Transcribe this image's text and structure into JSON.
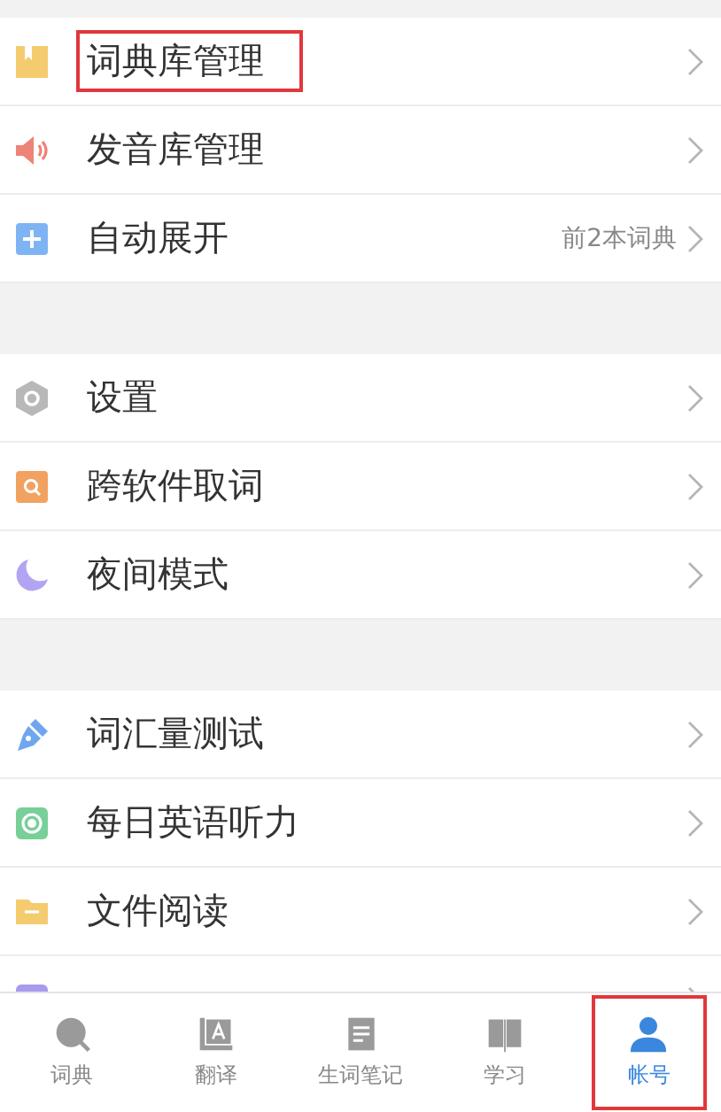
{
  "groups": [
    {
      "items": [
        {
          "kind": "book",
          "label": "词典库管理",
          "highlighted": true
        },
        {
          "kind": "speaker",
          "label": "发音库管理",
          "highlighted": false
        },
        {
          "kind": "plus",
          "label": "自动展开",
          "value": "前2本词典",
          "highlighted": false
        }
      ]
    },
    {
      "items": [
        {
          "kind": "hexagon",
          "label": "设置",
          "highlighted": false
        },
        {
          "kind": "search",
          "label": "跨软件取词",
          "highlighted": false
        },
        {
          "kind": "moon",
          "label": "夜间模式",
          "highlighted": false
        }
      ]
    },
    {
      "items": [
        {
          "kind": "pen",
          "label": "词汇量测试",
          "highlighted": false
        },
        {
          "kind": "record",
          "label": "每日英语听力",
          "highlighted": false
        },
        {
          "kind": "folder",
          "label": "文件阅读",
          "highlighted": false
        },
        {
          "kind": "wifi"
        }
      ]
    }
  ],
  "tabs": [
    {
      "kind": "search",
      "label": "词典",
      "selected": false,
      "highlighted": false
    },
    {
      "kind": "translate",
      "label": "翻译",
      "selected": false,
      "highlighted": false
    },
    {
      "kind": "note",
      "label": "生词笔记",
      "selected": false,
      "highlighted": false
    },
    {
      "kind": "book",
      "label": "学习",
      "selected": false,
      "highlighted": false
    },
    {
      "kind": "person",
      "label": "帐号",
      "selected": true,
      "highlighted": true
    }
  ]
}
